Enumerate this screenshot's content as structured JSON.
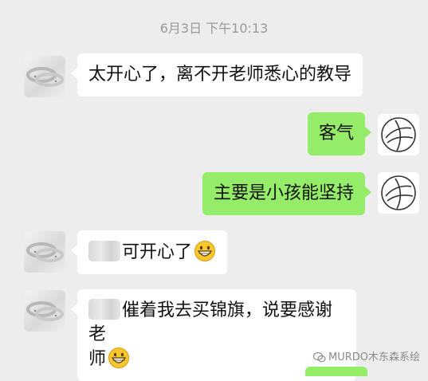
{
  "chat": {
    "timestamp": "6月3日 下午10:13",
    "messages": [
      {
        "side": "in",
        "text": "太开心了，离不开老师悉心的教导"
      },
      {
        "side": "out",
        "text": "客气"
      },
      {
        "side": "out",
        "text": "主要是小孩能坚持"
      },
      {
        "side": "in",
        "text": "可开心了",
        "redacted_prefix": true,
        "emoji": "grinning-face"
      },
      {
        "side": "in",
        "line1": "催着我去买锦旗，说要感谢老",
        "line2": "师",
        "redacted_prefix": true,
        "emoji": "grinning-face"
      }
    ]
  },
  "watermark": {
    "text": "MURDO木东森系绘",
    "icon": "wechat-icon"
  },
  "colors": {
    "background": "#ededed",
    "incoming_bubble": "#ffffff",
    "outgoing_bubble": "#95ec69",
    "timestamp": "#9a9a9a"
  }
}
